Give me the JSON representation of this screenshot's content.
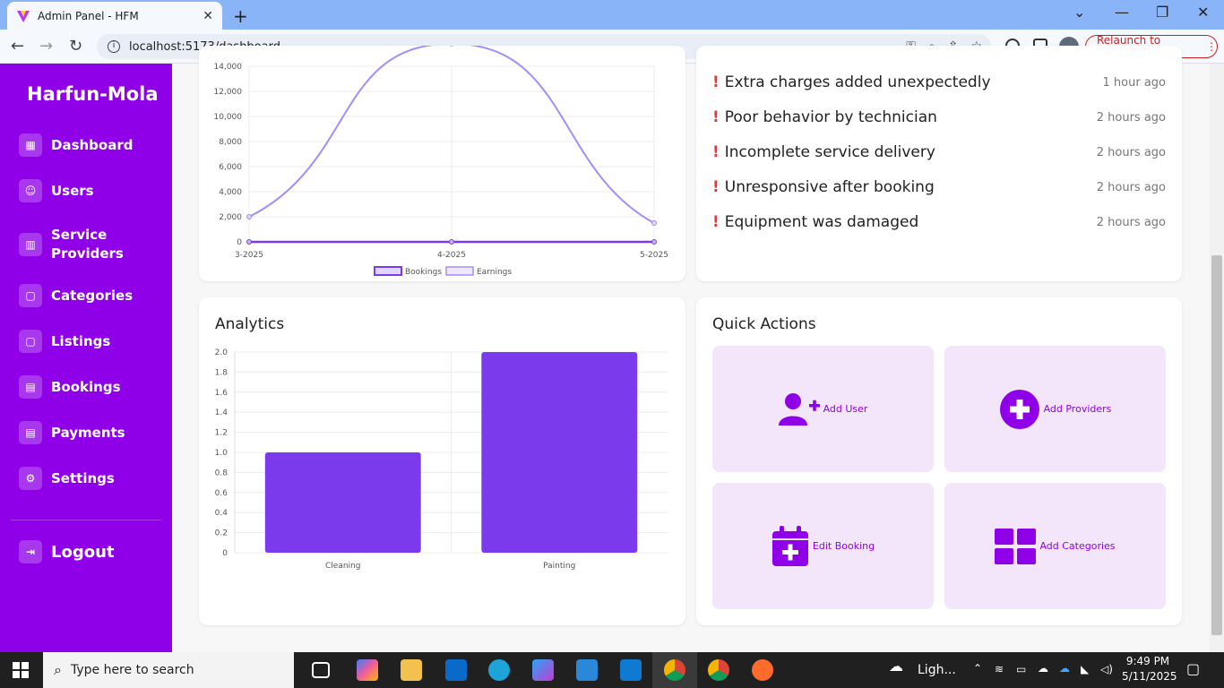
{
  "browser": {
    "tab_title": "Admin Panel - HFM",
    "url": "localhost:5173/dashboard",
    "relaunch_label": "Relaunch to update"
  },
  "sidebar": {
    "brand": "Harfun-Mola",
    "items": [
      {
        "label": "Dashboard",
        "icon": "grid-icon"
      },
      {
        "label": "Users",
        "icon": "users-icon"
      },
      {
        "label": "Service Providers",
        "icon": "building-icon"
      },
      {
        "label": "Categories",
        "icon": "clipboard-icon"
      },
      {
        "label": "Listings",
        "icon": "clipboard-icon"
      },
      {
        "label": "Bookings",
        "icon": "calendar-icon"
      },
      {
        "label": "Payments",
        "icon": "calendar-icon"
      },
      {
        "label": "Settings",
        "icon": "gear-icon"
      }
    ],
    "logout": "Logout"
  },
  "complaints": [
    {
      "text": "Extra charges added unexpectedly",
      "time": "1 hour ago"
    },
    {
      "text": "Poor behavior by technician",
      "time": "2 hours ago"
    },
    {
      "text": "Incomplete service delivery",
      "time": "2 hours ago"
    },
    {
      "text": "Unresponsive after booking",
      "time": "2 hours ago"
    },
    {
      "text": "Equipment was damaged",
      "time": "2 hours ago"
    }
  ],
  "analytics": {
    "title": "Analytics"
  },
  "quick_actions": {
    "title": "Quick Actions",
    "items": [
      {
        "label": "Add User",
        "icon": "user-plus-icon"
      },
      {
        "label": "Add Providers",
        "icon": "plus-circle-icon"
      },
      {
        "label": "Edit Booking",
        "icon": "calendar-plus-icon"
      },
      {
        "label": "Add Categories",
        "icon": "grid-large-icon"
      }
    ]
  },
  "taskbar": {
    "search_placeholder": "Type here to search",
    "weather": "Ligh...",
    "time": "9:49 PM",
    "date": "5/11/2025"
  },
  "colors": {
    "primary": "#8f00e8",
    "bar": "#7c3aed",
    "line": "#a78bfa",
    "tile": "#f3e6fb"
  },
  "chart_data": [
    {
      "type": "line",
      "x": [
        "3-2025",
        "4-2025",
        "5-2025"
      ],
      "series": [
        {
          "name": "Bookings",
          "values": [
            0,
            0,
            0
          ]
        },
        {
          "name": "Earnings",
          "values": [
            2000,
            15800,
            1500
          ]
        }
      ],
      "yticks": [
        0,
        2000,
        4000,
        6000,
        8000,
        10000,
        12000,
        14000
      ],
      "ytick_labels": [
        "0",
        "2,000",
        "4,000",
        "6,000",
        "8,000",
        "10,000",
        "12,000",
        "14,000"
      ],
      "ylim": [
        0,
        14000
      ],
      "legend": "bottom"
    },
    {
      "type": "bar",
      "categories": [
        "Cleaning",
        "Painting"
      ],
      "values": [
        1,
        2
      ],
      "yticks": [
        0,
        0.2,
        0.4,
        0.6,
        0.8,
        1.0,
        1.2,
        1.4,
        1.6,
        1.8,
        2.0
      ],
      "ytick_labels": [
        "0",
        "0.2",
        "0.4",
        "0.6",
        "0.8",
        "1.0",
        "1.2",
        "1.4",
        "1.6",
        "1.8",
        "2.0"
      ],
      "ylim": [
        0,
        2
      ]
    }
  ]
}
